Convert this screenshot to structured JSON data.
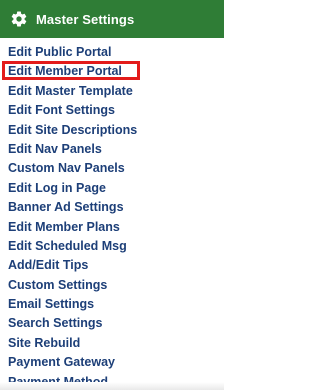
{
  "header": {
    "title": "Master Settings",
    "icon": "gear-icon",
    "color": "#2f7d36"
  },
  "menu": {
    "items": [
      {
        "label": "Edit Public Portal"
      },
      {
        "label": "Edit Member Portal",
        "highlighted": true
      },
      {
        "label": "Edit Master Template"
      },
      {
        "label": "Edit Font Settings"
      },
      {
        "label": "Edit Site Descriptions"
      },
      {
        "label": "Edit Nav Panels"
      },
      {
        "label": "Custom Nav Panels"
      },
      {
        "label": "Edit Log in Page"
      },
      {
        "label": "Banner Ad Settings"
      },
      {
        "label": "Edit Member Plans"
      },
      {
        "label": "Edit Scheduled Msg"
      },
      {
        "label": "Add/Edit Tips"
      },
      {
        "label": "Custom Settings"
      },
      {
        "label": "Email Settings"
      },
      {
        "label": "Search Settings"
      },
      {
        "label": "Site Rebuild"
      },
      {
        "label": "Payment Gateway"
      },
      {
        "label": "Payment Method"
      }
    ],
    "link_color": "#1d3f78",
    "highlight_color": "#e31b1b"
  }
}
